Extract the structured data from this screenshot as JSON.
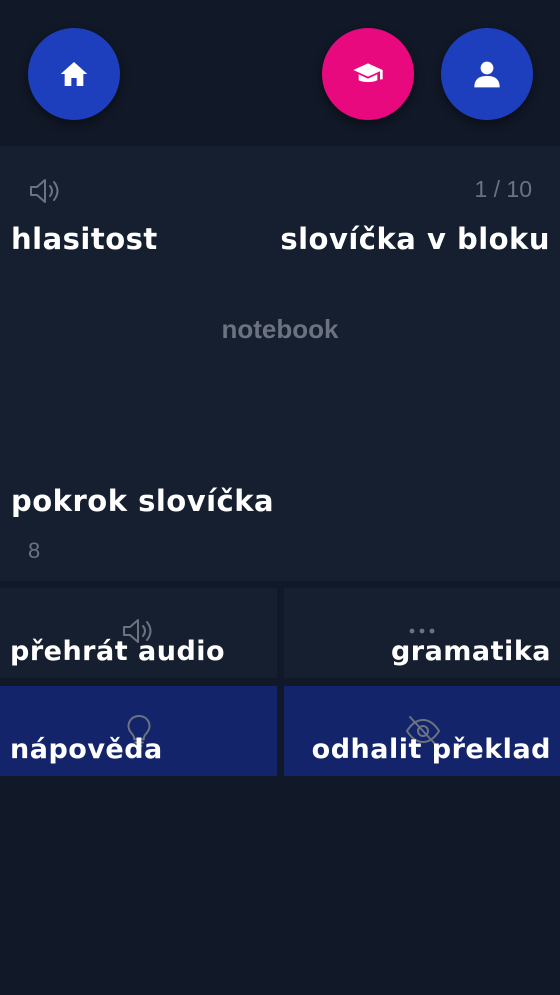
{
  "nav": {
    "home_icon": "home-icon",
    "learn_icon": "graduation-cap-icon",
    "profile_icon": "user-icon",
    "colors": {
      "blue": "#1e3fbd",
      "pink": "#e8097f"
    }
  },
  "card": {
    "volume_label": "hlasitost",
    "counter": "1 / 10",
    "words_in_block_label": "slovíčka v bloku",
    "word": "notebook",
    "progress_label": "pokrok slovíčka",
    "progress_value": "8"
  },
  "actions": {
    "play_audio": "přehrát audio",
    "grammar": "gramatika",
    "hint": "nápověda",
    "reveal_translation": "odhalit překlad"
  }
}
